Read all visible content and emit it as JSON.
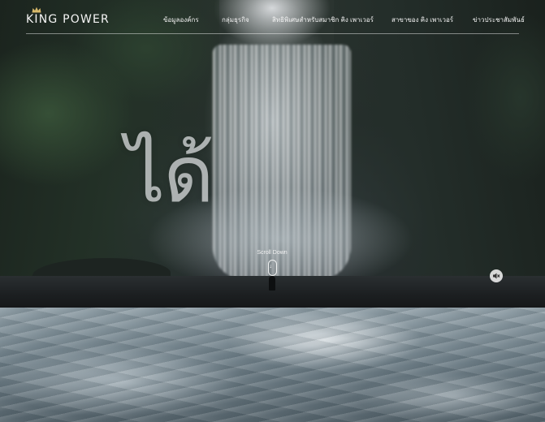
{
  "brand": {
    "logo_text": "KING POWER",
    "crown_icon": "crown-icon"
  },
  "nav": {
    "items": [
      {
        "label": "ข้อมูลองค์กร"
      },
      {
        "label": "กลุ่มธุรกิจ"
      },
      {
        "label": "สิทธิพิเศษสำหรับสมาชิก คิง เพาเวอร์"
      },
      {
        "label": "สาขาของ คิง เพาเวอร์"
      },
      {
        "label": "ข่าวประชาสัมพันธ์"
      }
    ]
  },
  "hero": {
    "headline": "ได้",
    "scroll_label": "Scroll Down",
    "scroll_icon": "arrow-down-icon",
    "mute_icon": "speaker-muted-icon"
  },
  "colors": {
    "nav_text": "#f2f2f2",
    "header_rule": "#ffffff",
    "headline": "#e2e4e6"
  }
}
